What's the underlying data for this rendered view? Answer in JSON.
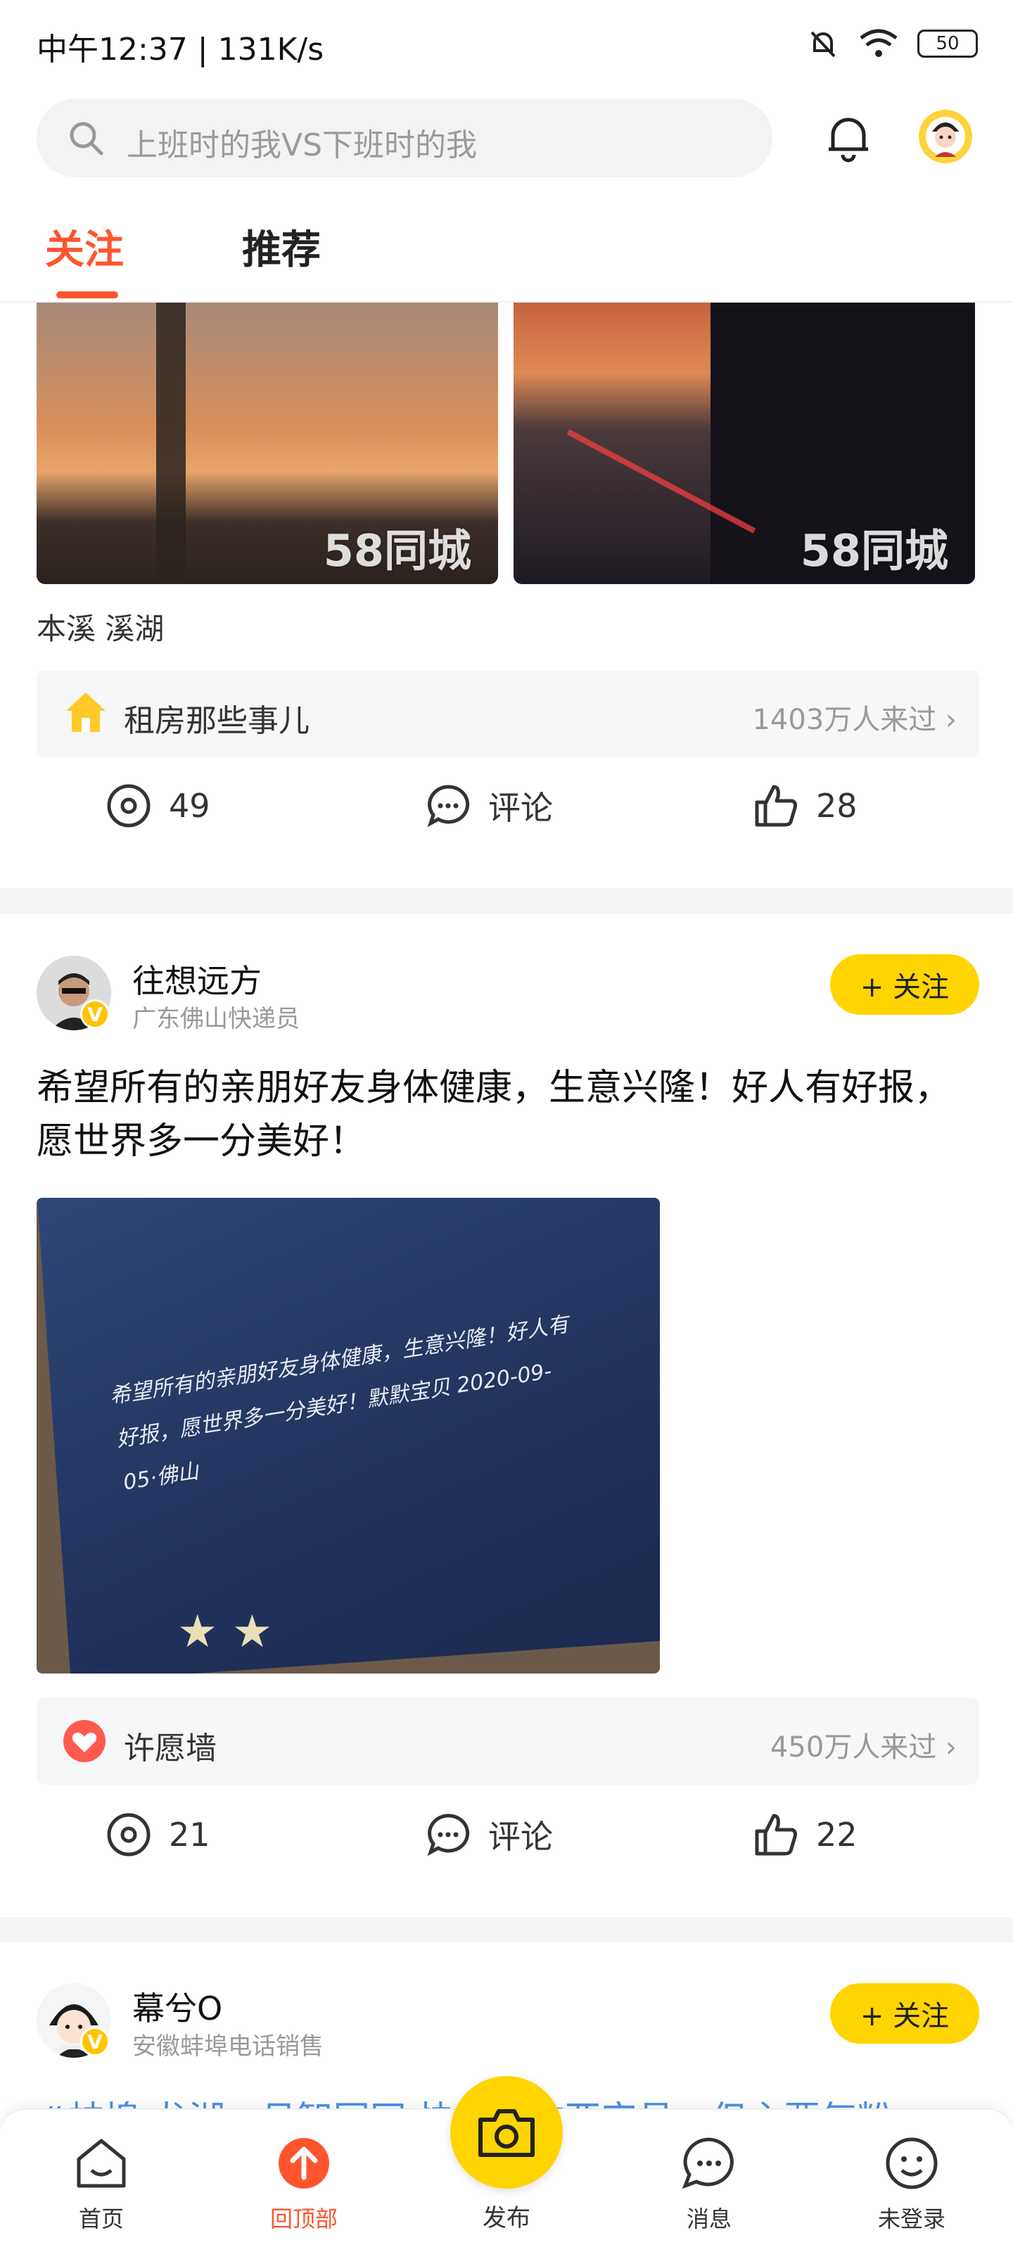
{
  "status_bar": {
    "time": "中午12:37 | 131K/s",
    "battery": "50"
  },
  "search": {
    "placeholder": "上班时的我VS下班时的我"
  },
  "tabs": [
    {
      "label": "关注",
      "active": true
    },
    {
      "label": "推荐",
      "active": false
    }
  ],
  "post1": {
    "location": "本溪 溪湖",
    "watermark": "58同城",
    "topic": {
      "name": "租房那些事儿",
      "count": "1403万人来过"
    },
    "views": "49",
    "comment_label": "评论",
    "likes": "28"
  },
  "post2": {
    "author": "往想远方",
    "subtitle": "广东佛山快递员",
    "follow_label": "+ 关注",
    "badge": "V",
    "text": "希望所有的亲朋好友身体健康，生意兴隆！好人有好报，愿世界多一分美好！",
    "image_caption": "希望所有的亲朋好友身体健康，生意兴隆！好人有好报，愿世界多一分美好！默默宝贝 2020-09-05·佛山",
    "topic": {
      "name": "许愿墙",
      "count": "450万人来过"
    },
    "views": "21",
    "comment_label": "评论",
    "likes": "22"
  },
  "post3": {
    "author": "幕兮O",
    "subtitle": "安徽蚌埠电话销售",
    "follow_label": "+ 关注",
    "badge": "V",
    "partial_text": "#蚌埠 龙湖 · 月智园网 快乐工作亚完员，但主要气粉"
  },
  "bottom_nav": [
    {
      "label": "首页",
      "icon": "home-icon"
    },
    {
      "label": "回顶部",
      "icon": "back-to-top-icon"
    },
    {
      "label": "发布",
      "icon": "camera-icon"
    },
    {
      "label": "消息",
      "icon": "message-icon"
    },
    {
      "label": "未登录",
      "icon": "user-icon"
    }
  ],
  "colors": {
    "accent": "#ff552e",
    "follow": "#ffd400",
    "link": "#4a90e2"
  }
}
